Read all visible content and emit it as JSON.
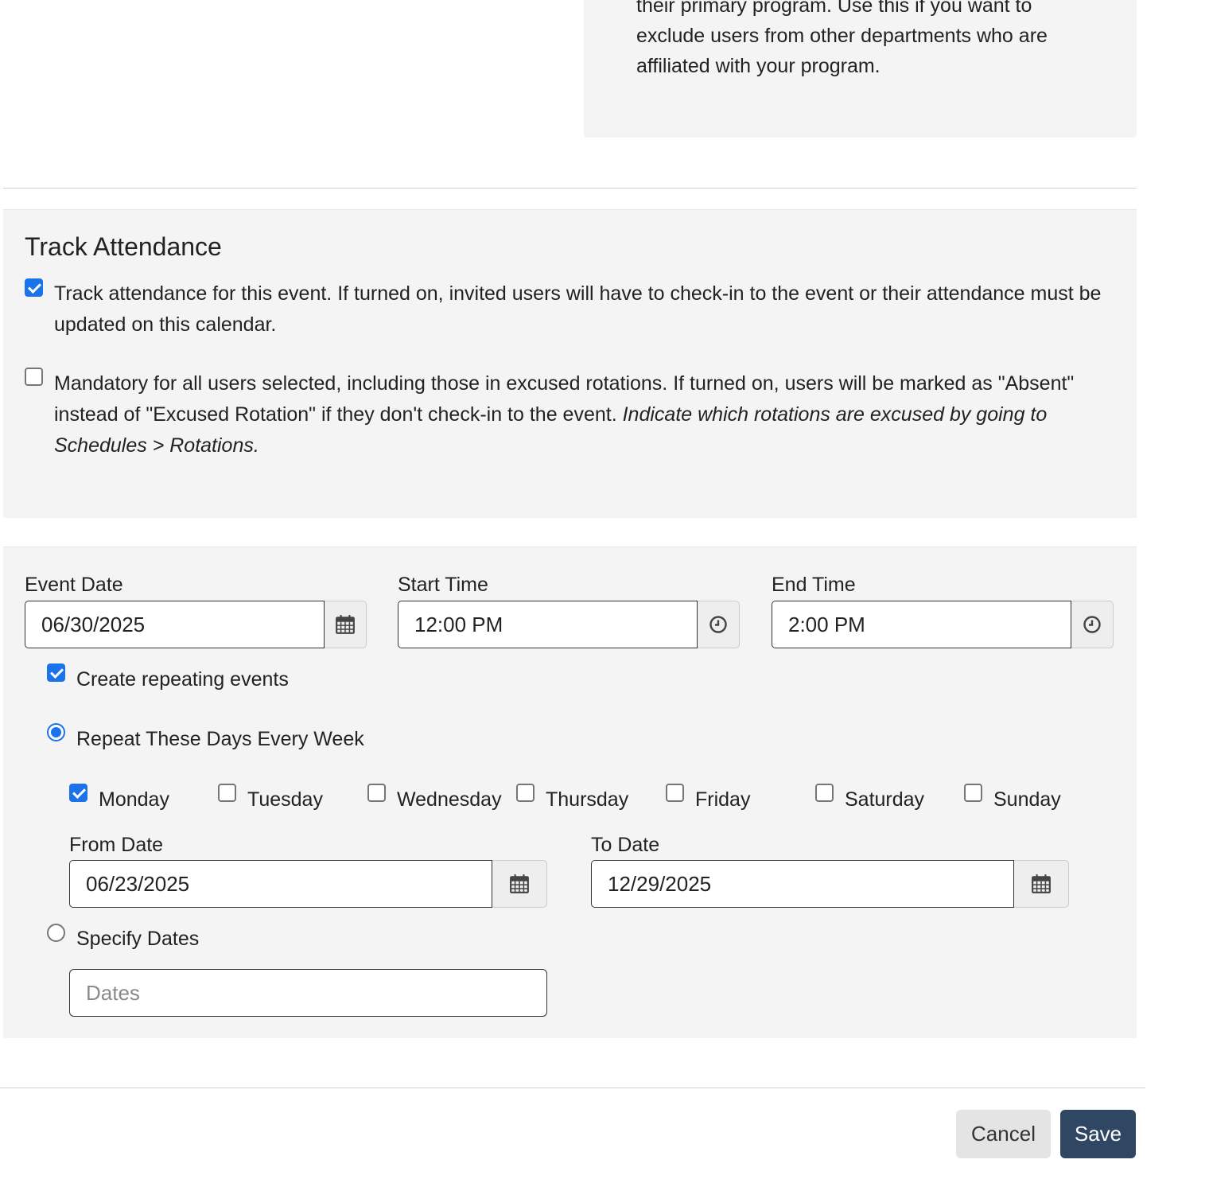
{
  "info_text": "their primary program. Use this if you want to exclude users from other departments who are affiliated with your program.",
  "attendance": {
    "title": "Track Attendance",
    "track_checked": true,
    "track_label": "Track attendance for this event. If turned on, invited users will have to check-in to the event or their attendance must be updated on this calendar.",
    "mandatory_checked": false,
    "mandatory_label": "Mandatory for all users selected, including those in excused rotations. If turned on, users will be marked as \"Absent\" instead of \"Excused Rotation\" if they don't check-in to the event. ",
    "mandatory_note": "Indicate which rotations are excused by going to Schedules > Rotations."
  },
  "event": {
    "date_label": "Event Date",
    "date_value": "06/30/2025",
    "start_label": "Start Time",
    "start_value": "12:00 PM",
    "end_label": "End Time",
    "end_value": "2:00 PM"
  },
  "repeat": {
    "create_label": "Create repeating events",
    "create_checked": true,
    "weekly_label": "Repeat These Days Every Week",
    "weekly_selected": true,
    "days": [
      {
        "label": "Monday",
        "checked": true
      },
      {
        "label": "Tuesday",
        "checked": false
      },
      {
        "label": "Wednesday",
        "checked": false
      },
      {
        "label": "Thursday",
        "checked": false
      },
      {
        "label": "Friday",
        "checked": false
      },
      {
        "label": "Saturday",
        "checked": false
      },
      {
        "label": "Sunday",
        "checked": false
      }
    ],
    "from_label": "From Date",
    "from_value": "06/23/2025",
    "to_label": "To Date",
    "to_value": "12/29/2025",
    "specify_label": "Specify Dates",
    "specify_selected": false,
    "dates_placeholder": "Dates",
    "dates_value": ""
  },
  "footer": {
    "cancel_label": "Cancel",
    "save_label": "Save"
  },
  "colors": {
    "accent": "#1a73e8",
    "save_button": "#2f4763",
    "panel_bg": "#f4f4f4"
  }
}
